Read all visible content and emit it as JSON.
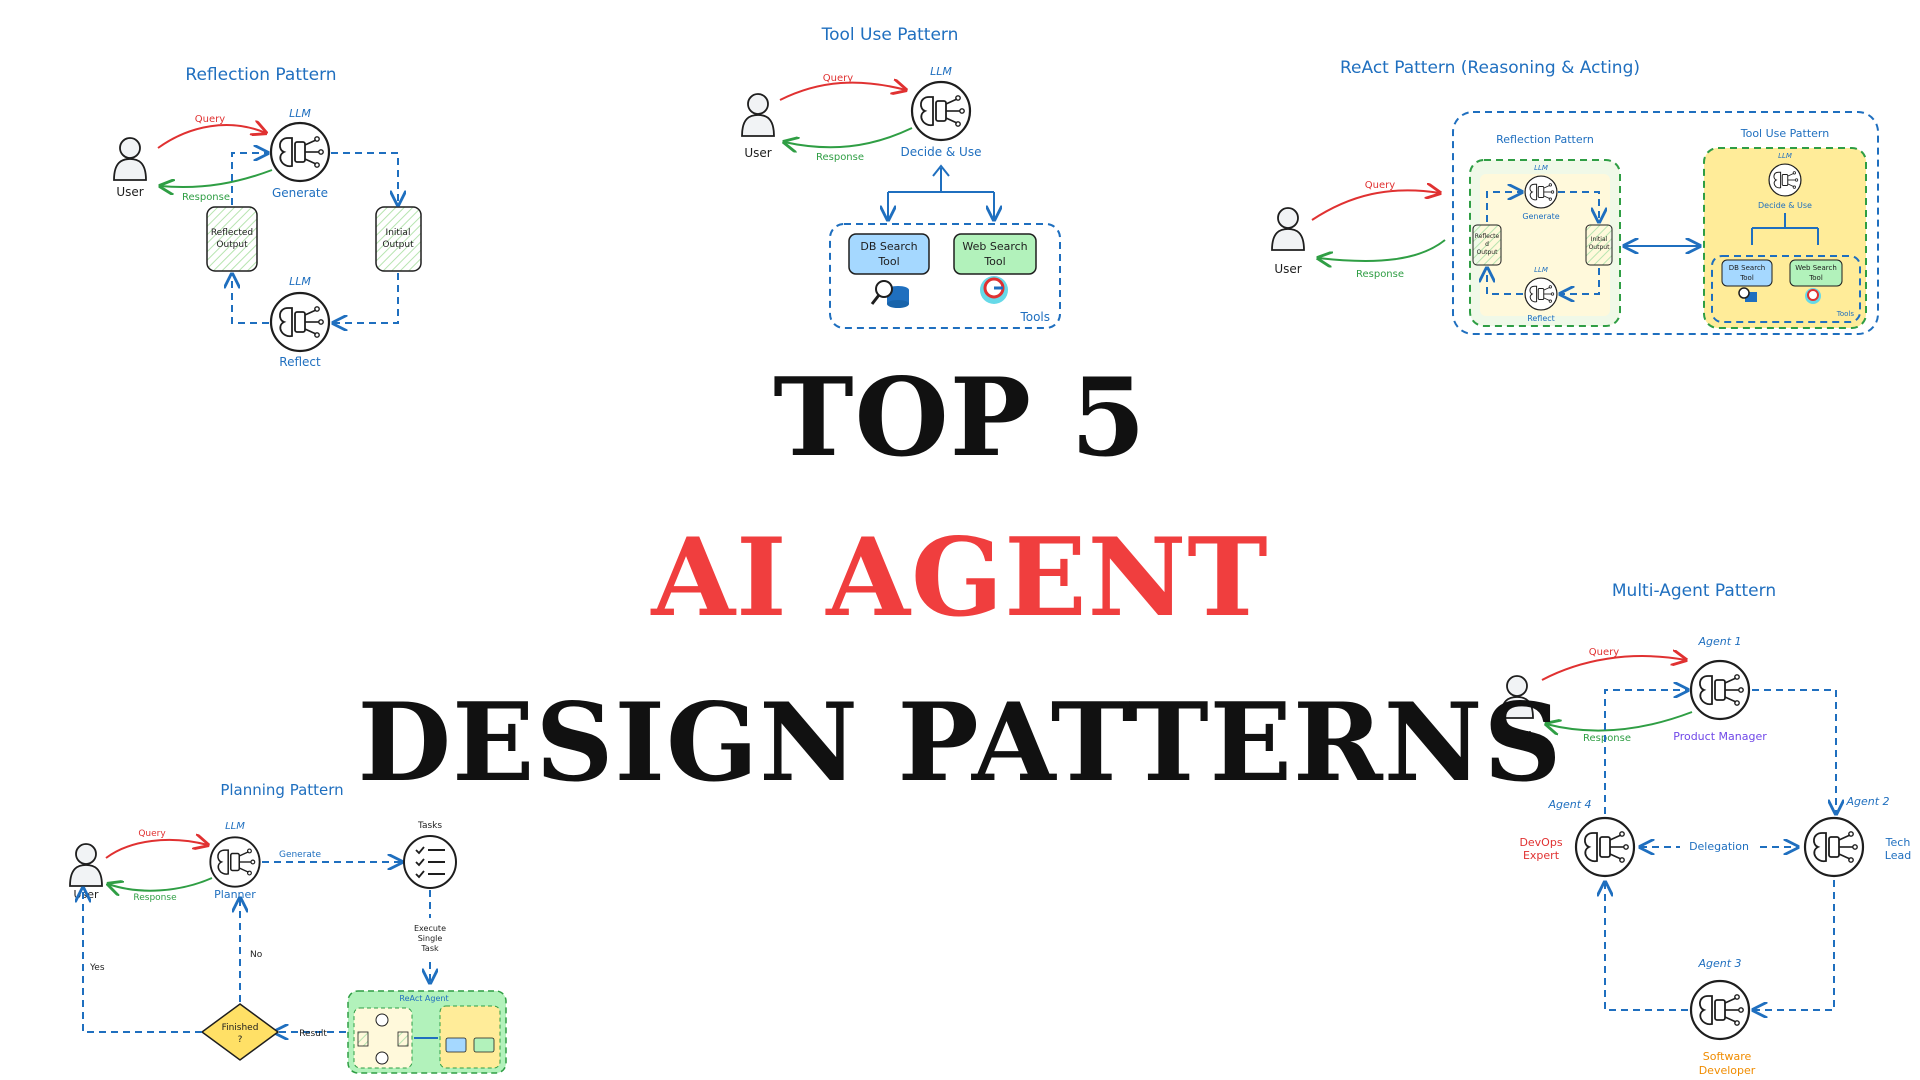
{
  "headline": {
    "line1": "TOP 5",
    "line2": "AI AGENT",
    "line3": "DESIGN PATTERNS",
    "line2_color": "#f03e3e"
  },
  "common": {
    "user": "User",
    "llm": "LLM",
    "query": "Query",
    "response": "Response"
  },
  "reflection": {
    "title": "Reflection Pattern",
    "generate": "Generate",
    "reflect": "Reflect",
    "initial_output": [
      "Initial",
      "Output"
    ],
    "reflected_output": [
      "Reflected",
      "Output"
    ]
  },
  "tool_use": {
    "title": "Tool Use Pattern",
    "decide": "Decide & Use",
    "db_tool": [
      "DB Search",
      "Tool"
    ],
    "web_tool": [
      "Web Search",
      "Tool"
    ],
    "tools": "Tools"
  },
  "react": {
    "title": "ReAct Pattern (Reasoning & Acting)",
    "reflection_title": "Reflection Pattern",
    "tooluse_title": "Tool Use Pattern",
    "generate": "Generate",
    "reflect": "Reflect",
    "initial_output": [
      "Initial",
      "Output"
    ],
    "reflected_output": [
      "Reflecte",
      "d",
      "Output"
    ],
    "decide": "Decide & Use",
    "db_tool": [
      "DB Search",
      "Tool"
    ],
    "web_tool": [
      "Web Search",
      "Tool"
    ],
    "tools": "Tools"
  },
  "planning": {
    "title": "Planning Pattern",
    "planner": "Planner",
    "generate": "Generate",
    "tasks": "Tasks",
    "execute": [
      "Execute",
      "Single",
      "Task"
    ],
    "result": "Result",
    "finished": [
      "Finished",
      "?"
    ],
    "yes": "Yes",
    "no": "No",
    "react_agent": "ReAct Agent"
  },
  "multi_agent": {
    "title": "Multi-Agent Pattern",
    "agent1": "Agent 1",
    "agent1_role": "Product Manager",
    "agent2": "Agent 2",
    "agent2_role": [
      "Tech",
      "Lead"
    ],
    "agent3": "Agent 3",
    "agent3_role": [
      "Software",
      "Developer"
    ],
    "agent4": "Agent 4",
    "agent4_role": [
      "DevOps",
      "Expert"
    ],
    "delegation": "Delegation"
  },
  "colors": {
    "blue": "#1f6fbf",
    "red": "#e03131",
    "green": "#2f9e44",
    "yellow_box": "#ffec99",
    "light_green_box": "#e9f7e4",
    "cream_box": "#fff9db",
    "tool_blue": "#a5d8ff",
    "tool_green": "#b2f2bb"
  }
}
